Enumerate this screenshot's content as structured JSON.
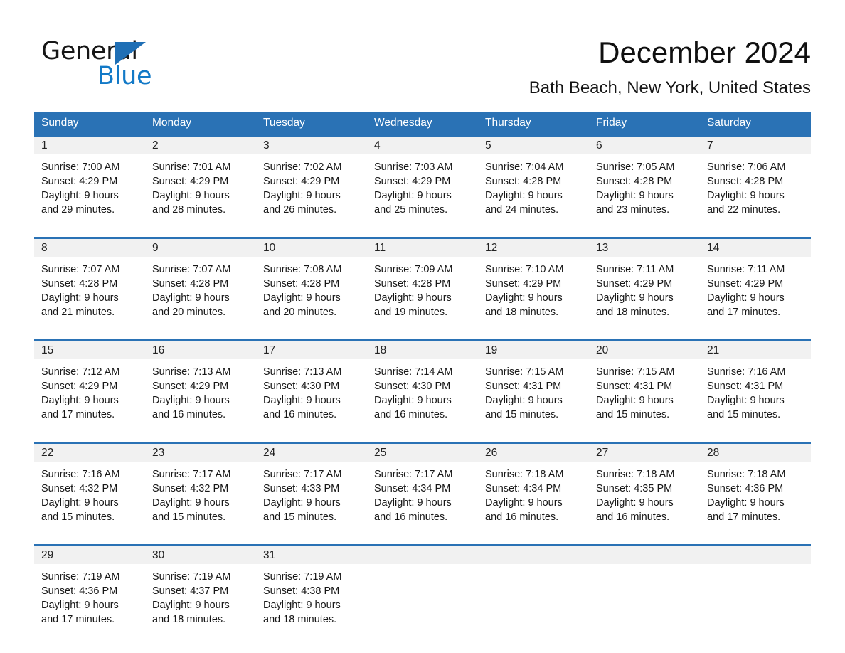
{
  "brand": {
    "logo_word_1": "General",
    "logo_word_2": "Blue",
    "triangle_icon": "blue-triangle-icon",
    "accent_color": "#2a72b5",
    "logo_blue": "#1279c7",
    "band_gray": "#f1f1f1"
  },
  "header": {
    "title": "December 2024",
    "location": "Bath Beach, New York, United States"
  },
  "calendar": {
    "weekdays": [
      "Sunday",
      "Monday",
      "Tuesday",
      "Wednesday",
      "Thursday",
      "Friday",
      "Saturday"
    ],
    "weeks": [
      [
        {
          "day": "1",
          "sunrise": "Sunrise: 7:00 AM",
          "sunset": "Sunset: 4:29 PM",
          "daylight_1": "Daylight: 9 hours",
          "daylight_2": "and 29 minutes."
        },
        {
          "day": "2",
          "sunrise": "Sunrise: 7:01 AM",
          "sunset": "Sunset: 4:29 PM",
          "daylight_1": "Daylight: 9 hours",
          "daylight_2": "and 28 minutes."
        },
        {
          "day": "3",
          "sunrise": "Sunrise: 7:02 AM",
          "sunset": "Sunset: 4:29 PM",
          "daylight_1": "Daylight: 9 hours",
          "daylight_2": "and 26 minutes."
        },
        {
          "day": "4",
          "sunrise": "Sunrise: 7:03 AM",
          "sunset": "Sunset: 4:29 PM",
          "daylight_1": "Daylight: 9 hours",
          "daylight_2": "and 25 minutes."
        },
        {
          "day": "5",
          "sunrise": "Sunrise: 7:04 AM",
          "sunset": "Sunset: 4:28 PM",
          "daylight_1": "Daylight: 9 hours",
          "daylight_2": "and 24 minutes."
        },
        {
          "day": "6",
          "sunrise": "Sunrise: 7:05 AM",
          "sunset": "Sunset: 4:28 PM",
          "daylight_1": "Daylight: 9 hours",
          "daylight_2": "and 23 minutes."
        },
        {
          "day": "7",
          "sunrise": "Sunrise: 7:06 AM",
          "sunset": "Sunset: 4:28 PM",
          "daylight_1": "Daylight: 9 hours",
          "daylight_2": "and 22 minutes."
        }
      ],
      [
        {
          "day": "8",
          "sunrise": "Sunrise: 7:07 AM",
          "sunset": "Sunset: 4:28 PM",
          "daylight_1": "Daylight: 9 hours",
          "daylight_2": "and 21 minutes."
        },
        {
          "day": "9",
          "sunrise": "Sunrise: 7:07 AM",
          "sunset": "Sunset: 4:28 PM",
          "daylight_1": "Daylight: 9 hours",
          "daylight_2": "and 20 minutes."
        },
        {
          "day": "10",
          "sunrise": "Sunrise: 7:08 AM",
          "sunset": "Sunset: 4:28 PM",
          "daylight_1": "Daylight: 9 hours",
          "daylight_2": "and 20 minutes."
        },
        {
          "day": "11",
          "sunrise": "Sunrise: 7:09 AM",
          "sunset": "Sunset: 4:28 PM",
          "daylight_1": "Daylight: 9 hours",
          "daylight_2": "and 19 minutes."
        },
        {
          "day": "12",
          "sunrise": "Sunrise: 7:10 AM",
          "sunset": "Sunset: 4:29 PM",
          "daylight_1": "Daylight: 9 hours",
          "daylight_2": "and 18 minutes."
        },
        {
          "day": "13",
          "sunrise": "Sunrise: 7:11 AM",
          "sunset": "Sunset: 4:29 PM",
          "daylight_1": "Daylight: 9 hours",
          "daylight_2": "and 18 minutes."
        },
        {
          "day": "14",
          "sunrise": "Sunrise: 7:11 AM",
          "sunset": "Sunset: 4:29 PM",
          "daylight_1": "Daylight: 9 hours",
          "daylight_2": "and 17 minutes."
        }
      ],
      [
        {
          "day": "15",
          "sunrise": "Sunrise: 7:12 AM",
          "sunset": "Sunset: 4:29 PM",
          "daylight_1": "Daylight: 9 hours",
          "daylight_2": "and 17 minutes."
        },
        {
          "day": "16",
          "sunrise": "Sunrise: 7:13 AM",
          "sunset": "Sunset: 4:29 PM",
          "daylight_1": "Daylight: 9 hours",
          "daylight_2": "and 16 minutes."
        },
        {
          "day": "17",
          "sunrise": "Sunrise: 7:13 AM",
          "sunset": "Sunset: 4:30 PM",
          "daylight_1": "Daylight: 9 hours",
          "daylight_2": "and 16 minutes."
        },
        {
          "day": "18",
          "sunrise": "Sunrise: 7:14 AM",
          "sunset": "Sunset: 4:30 PM",
          "daylight_1": "Daylight: 9 hours",
          "daylight_2": "and 16 minutes."
        },
        {
          "day": "19",
          "sunrise": "Sunrise: 7:15 AM",
          "sunset": "Sunset: 4:31 PM",
          "daylight_1": "Daylight: 9 hours",
          "daylight_2": "and 15 minutes."
        },
        {
          "day": "20",
          "sunrise": "Sunrise: 7:15 AM",
          "sunset": "Sunset: 4:31 PM",
          "daylight_1": "Daylight: 9 hours",
          "daylight_2": "and 15 minutes."
        },
        {
          "day": "21",
          "sunrise": "Sunrise: 7:16 AM",
          "sunset": "Sunset: 4:31 PM",
          "daylight_1": "Daylight: 9 hours",
          "daylight_2": "and 15 minutes."
        }
      ],
      [
        {
          "day": "22",
          "sunrise": "Sunrise: 7:16 AM",
          "sunset": "Sunset: 4:32 PM",
          "daylight_1": "Daylight: 9 hours",
          "daylight_2": "and 15 minutes."
        },
        {
          "day": "23",
          "sunrise": "Sunrise: 7:17 AM",
          "sunset": "Sunset: 4:32 PM",
          "daylight_1": "Daylight: 9 hours",
          "daylight_2": "and 15 minutes."
        },
        {
          "day": "24",
          "sunrise": "Sunrise: 7:17 AM",
          "sunset": "Sunset: 4:33 PM",
          "daylight_1": "Daylight: 9 hours",
          "daylight_2": "and 15 minutes."
        },
        {
          "day": "25",
          "sunrise": "Sunrise: 7:17 AM",
          "sunset": "Sunset: 4:34 PM",
          "daylight_1": "Daylight: 9 hours",
          "daylight_2": "and 16 minutes."
        },
        {
          "day": "26",
          "sunrise": "Sunrise: 7:18 AM",
          "sunset": "Sunset: 4:34 PM",
          "daylight_1": "Daylight: 9 hours",
          "daylight_2": "and 16 minutes."
        },
        {
          "day": "27",
          "sunrise": "Sunrise: 7:18 AM",
          "sunset": "Sunset: 4:35 PM",
          "daylight_1": "Daylight: 9 hours",
          "daylight_2": "and 16 minutes."
        },
        {
          "day": "28",
          "sunrise": "Sunrise: 7:18 AM",
          "sunset": "Sunset: 4:36 PM",
          "daylight_1": "Daylight: 9 hours",
          "daylight_2": "and 17 minutes."
        }
      ],
      [
        {
          "day": "29",
          "sunrise": "Sunrise: 7:19 AM",
          "sunset": "Sunset: 4:36 PM",
          "daylight_1": "Daylight: 9 hours",
          "daylight_2": "and 17 minutes."
        },
        {
          "day": "30",
          "sunrise": "Sunrise: 7:19 AM",
          "sunset": "Sunset: 4:37 PM",
          "daylight_1": "Daylight: 9 hours",
          "daylight_2": "and 18 minutes."
        },
        {
          "day": "31",
          "sunrise": "Sunrise: 7:19 AM",
          "sunset": "Sunset: 4:38 PM",
          "daylight_1": "Daylight: 9 hours",
          "daylight_2": "and 18 minutes."
        },
        {
          "day": "",
          "sunrise": "",
          "sunset": "",
          "daylight_1": "",
          "daylight_2": ""
        },
        {
          "day": "",
          "sunrise": "",
          "sunset": "",
          "daylight_1": "",
          "daylight_2": ""
        },
        {
          "day": "",
          "sunrise": "",
          "sunset": "",
          "daylight_1": "",
          "daylight_2": ""
        },
        {
          "day": "",
          "sunrise": "",
          "sunset": "",
          "daylight_1": "",
          "daylight_2": ""
        }
      ]
    ]
  }
}
